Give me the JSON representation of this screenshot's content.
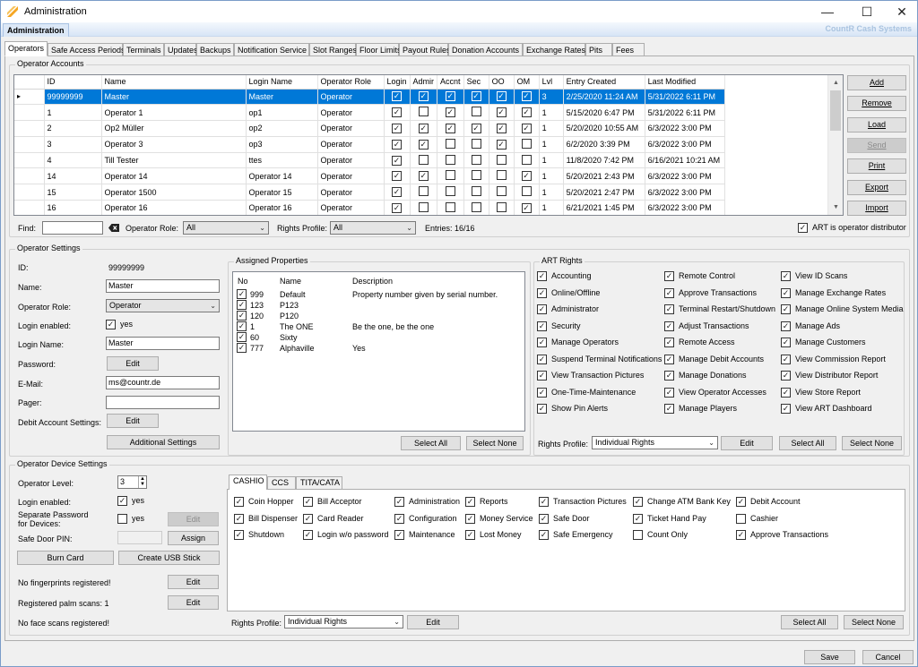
{
  "window": {
    "title": "Administration",
    "minimize": "—",
    "maximize": "☐",
    "close": "✕"
  },
  "ribbon": {
    "tab": "Administration",
    "brand": "CountR Cash Systems"
  },
  "tabs": [
    "Operators",
    "Safe Access Periods",
    "Terminals",
    "Updates",
    "Backups",
    "Notification Service",
    "Slot Ranges",
    "Floor Limits",
    "Payout Rules",
    "Donation Accounts",
    "Exchange Rates",
    "Pits",
    "Fees"
  ],
  "operator_accounts": {
    "title": "Operator Accounts",
    "columns": [
      "ID",
      "Name",
      "Login Name",
      "Operator Role",
      "Login",
      "Admir",
      "Accnt",
      "Sec",
      "OO",
      "OM",
      "Lvl",
      "Entry Created",
      "Last Modified"
    ],
    "rows": [
      {
        "id": "99999999",
        "name": "Master",
        "login": "Master",
        "role": "Operator",
        "flags": [
          1,
          1,
          1,
          1,
          1,
          1
        ],
        "lvl": "3",
        "created": "2/25/2020 11:24 AM",
        "modified": "5/31/2022 6:11 PM"
      },
      {
        "id": "1",
        "name": "Operator 1",
        "login": "op1",
        "role": "Operator",
        "flags": [
          1,
          0,
          1,
          0,
          1,
          1
        ],
        "lvl": "1",
        "created": "5/15/2020 6:47 PM",
        "modified": "5/31/2022 6:11 PM"
      },
      {
        "id": "2",
        "name": "Op2 Müller",
        "login": "op2",
        "role": "Operator",
        "flags": [
          1,
          1,
          1,
          1,
          1,
          1
        ],
        "lvl": "1",
        "created": "5/20/2020 10:55 AM",
        "modified": "6/3/2022 3:00 PM"
      },
      {
        "id": "3",
        "name": "Operator 3",
        "login": "op3",
        "role": "Operator",
        "flags": [
          1,
          1,
          0,
          0,
          1,
          0
        ],
        "lvl": "1",
        "created": "6/2/2020 3:39 PM",
        "modified": "6/3/2022 3:00 PM"
      },
      {
        "id": "4",
        "name": "Till Tester",
        "login": "ttes",
        "role": "Operator",
        "flags": [
          1,
          0,
          0,
          0,
          0,
          0
        ],
        "lvl": "1",
        "created": "11/8/2020 7:42 PM",
        "modified": "6/16/2021 10:21 AM"
      },
      {
        "id": "14",
        "name": "Operator 14",
        "login": "Operator 14",
        "role": "Operator",
        "flags": [
          1,
          1,
          0,
          0,
          0,
          1
        ],
        "lvl": "1",
        "created": "5/20/2021 2:43 PM",
        "modified": "6/3/2022 3:00 PM"
      },
      {
        "id": "15",
        "name": "Operator 1500",
        "login": "Operator 15",
        "role": "Operator",
        "flags": [
          1,
          0,
          0,
          0,
          0,
          0
        ],
        "lvl": "1",
        "created": "5/20/2021 2:47 PM",
        "modified": "6/3/2022 3:00 PM"
      },
      {
        "id": "16",
        "name": "Operator 16",
        "login": "Operator 16",
        "role": "Operator",
        "flags": [
          1,
          0,
          0,
          0,
          0,
          1
        ],
        "lvl": "1",
        "created": "6/21/2021 1:45 PM",
        "modified": "6/3/2022 3:00 PM"
      }
    ],
    "buttons": [
      "Add",
      "Remove",
      "Load",
      "Send",
      "Print",
      "Export",
      "Import"
    ],
    "find_label": "Find:",
    "find_value": "",
    "role_label": "Operator Role:",
    "role_value": "All",
    "rights_label": "Rights Profile:",
    "rights_value": "All",
    "entries": "Entries: 16/16",
    "art_distributor": "ART is operator distributor"
  },
  "operator_settings": {
    "title": "Operator Settings",
    "id_label": "ID:",
    "id_value": "99999999",
    "name_label": "Name:",
    "name_value": "Master",
    "role_label": "Operator Role:",
    "role_value": "Operator",
    "login_enabled_label": "Login enabled:",
    "login_enabled_value": "yes",
    "login_name_label": "Login Name:",
    "login_name_value": "Master",
    "password_label": "Password:",
    "password_button": "Edit",
    "email_label": "E-Mail:",
    "email_value": "ms@countr.de",
    "pager_label": "Pager:",
    "pager_value": "",
    "debit_label": "Debit Account Settings:",
    "debit_button": "Edit",
    "additional_button": "Additional Settings"
  },
  "assigned_properties": {
    "title": "Assigned Properties",
    "columns": [
      "No",
      "Name",
      "Description"
    ],
    "rows": [
      {
        "no": "999",
        "name": "Default",
        "desc": "Property number given by serial number."
      },
      {
        "no": "123",
        "name": "P123",
        "desc": ""
      },
      {
        "no": "120",
        "name": "P120",
        "desc": ""
      },
      {
        "no": "1",
        "name": "The ONE",
        "desc": "Be the one, be the one"
      },
      {
        "no": "60",
        "name": "Sixty",
        "desc": ""
      },
      {
        "no": "777",
        "name": "Alphaville",
        "desc": "Yes"
      }
    ],
    "select_all": "Select All",
    "select_none": "Select None"
  },
  "art_rights": {
    "title": "ART Rights",
    "col1": [
      "Accounting",
      "Online/Offline",
      "Administrator",
      "Security",
      "Manage Operators",
      "Suspend Terminal Notifications",
      "View Transaction Pictures",
      "One-Time-Maintenance",
      "Show Pin Alerts"
    ],
    "col2": [
      "Remote Control",
      "Approve Transactions",
      "Terminal Restart/Shutdown",
      "Adjust Transactions",
      "Remote Access",
      "Manage Debit Accounts",
      "Manage Donations",
      "View Operator Accesses",
      "Manage Players"
    ],
    "col3": [
      "View ID Scans",
      "Manage Exchange Rates",
      "Manage Online System Media",
      "Manage Ads",
      "Manage Customers",
      "View Commission Report",
      "View Distributor Report",
      "View Store Report",
      "View ART Dashboard"
    ],
    "rights_label": "Rights Profile:",
    "rights_value": "Individual Rights",
    "edit": "Edit",
    "select_all": "Select All",
    "select_none": "Select None"
  },
  "device_settings": {
    "title": "Operator Device Settings",
    "level_label": "Operator Level:",
    "level_value": "3",
    "login_enabled_label": "Login enabled:",
    "login_enabled_value": "yes",
    "sep_password_label1": "Separate Password",
    "sep_password_label2": "for Devices:",
    "sep_password_value": "yes",
    "sep_password_edit": "Edit",
    "pin_label": "Safe Door PIN:",
    "pin_value": "",
    "pin_assign": "Assign",
    "burn_card": "Burn Card",
    "usb_stick": "Create USB Stick",
    "fingerprints": "No fingerprints registered!",
    "fingerprints_edit": "Edit",
    "palm": "Registered palm scans: 1",
    "palm_edit": "Edit",
    "face": "No face scans registered!"
  },
  "device_rights": {
    "tabs": [
      "CASHIO",
      "CCS",
      "TITA/CATA"
    ],
    "columns": [
      [
        {
          "l": "Coin Hopper",
          "c": 1
        },
        {
          "l": "Bill Dispenser",
          "c": 1
        },
        {
          "l": "Shutdown",
          "c": 1
        }
      ],
      [
        {
          "l": "Bill Acceptor",
          "c": 1
        },
        {
          "l": "Card Reader",
          "c": 1
        },
        {
          "l": "Login w/o password",
          "c": 1
        }
      ],
      [
        {
          "l": "Administration",
          "c": 1
        },
        {
          "l": "Configuration",
          "c": 1
        },
        {
          "l": "Maintenance",
          "c": 1
        }
      ],
      [
        {
          "l": "Reports",
          "c": 1
        },
        {
          "l": "Money Service",
          "c": 1
        },
        {
          "l": "Lost Money",
          "c": 1
        }
      ],
      [
        {
          "l": "Transaction Pictures",
          "c": 1
        },
        {
          "l": "Safe Door",
          "c": 1
        },
        {
          "l": "Safe Emergency",
          "c": 1
        }
      ],
      [
        {
          "l": "Change ATM Bank Key",
          "c": 1
        },
        {
          "l": "Ticket Hand Pay",
          "c": 1
        },
        {
          "l": "Count Only",
          "c": 0
        }
      ],
      [
        {
          "l": "Debit Account",
          "c": 1
        },
        {
          "l": "Cashier",
          "c": 0
        },
        {
          "l": "Approve Transactions",
          "c": 1
        }
      ]
    ],
    "rights_label": "Rights Profile:",
    "rights_value": "Individual Rights",
    "edit": "Edit",
    "select_all": "Select All",
    "select_none": "Select None"
  },
  "footer": {
    "save": "Save",
    "cancel": "Cancel"
  },
  "colors": {
    "selection": "#0078d7",
    "brand": "#a9c3e0",
    "logo": "#f5a623"
  }
}
